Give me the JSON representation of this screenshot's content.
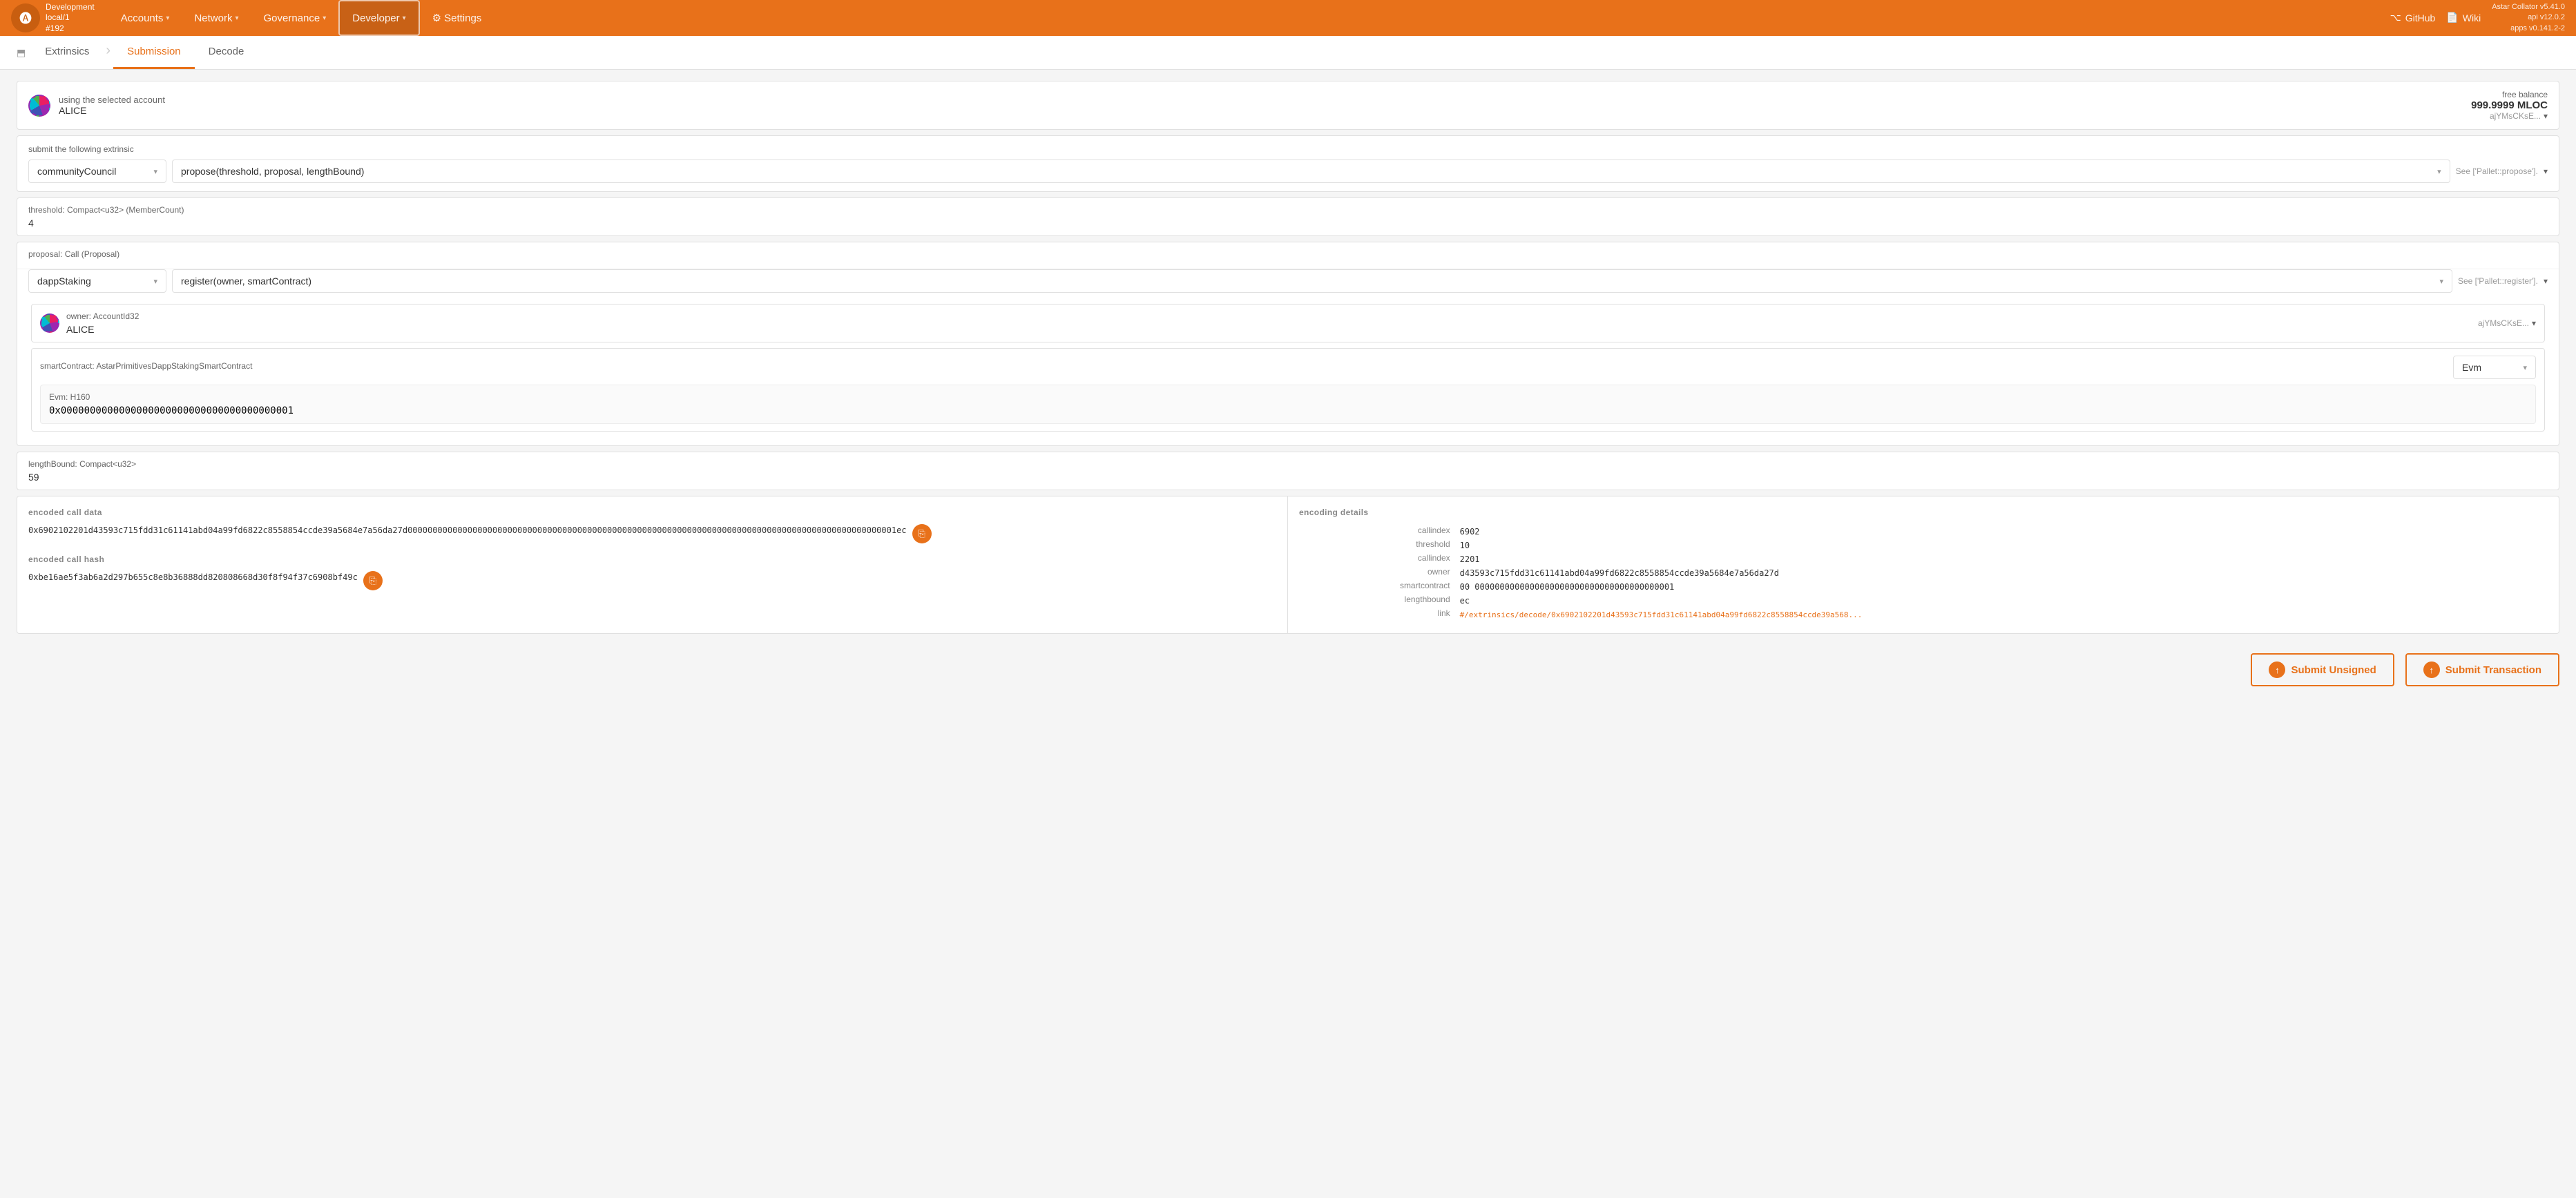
{
  "nav": {
    "logo_text": "A",
    "network_name": "Development",
    "network_sub": "local/1",
    "network_id": "#192",
    "items": [
      {
        "label": "Accounts",
        "has_dropdown": true,
        "active": false
      },
      {
        "label": "Network",
        "has_dropdown": true,
        "active": false
      },
      {
        "label": "Governance",
        "has_dropdown": true,
        "active": false
      },
      {
        "label": "Developer",
        "has_dropdown": true,
        "active": true
      },
      {
        "label": "Settings",
        "has_dropdown": false,
        "active": false
      }
    ],
    "right_items": [
      {
        "label": "GitHub",
        "icon": "github-icon"
      },
      {
        "label": "Wiki",
        "icon": "wiki-icon"
      }
    ],
    "version": "Astar Collator v5.41.0",
    "api_version": "api v12.0.2",
    "apps_version": "apps v0.141.2-2"
  },
  "tabs": {
    "icon": "⬒",
    "items": [
      {
        "label": "Extrinsics",
        "active": false
      },
      {
        "label": "Submission",
        "active": true
      },
      {
        "label": "Decode",
        "active": false
      }
    ]
  },
  "account_section": {
    "label": "using the selected account",
    "account_name": "ALICE",
    "free_balance_label": "free balance",
    "free_balance_value": "999.9999 MLOC",
    "account_address": "ajYMsCKsE..."
  },
  "extrinsic_section": {
    "label": "submit the following extrinsic",
    "pallet": "communityCouncil",
    "call": "propose(threshold, proposal, lengthBound)",
    "see_link": "See ['Pallet::propose']."
  },
  "params": {
    "threshold": {
      "label": "threshold: Compact<u32> (MemberCount)",
      "value": "4"
    },
    "proposal": {
      "label": "proposal: Call (Proposal)",
      "pallet": "dappStaking",
      "call": "register(owner, smartContract)",
      "see_link": "See ['Pallet::register'].",
      "owner": {
        "label": "owner: AccountId32",
        "account_name": "ALICE",
        "account_address": "ajYMsCKsE..."
      },
      "smartContract": {
        "label": "smartContract: AstarPrimitivesDappStakingSmartContract",
        "type": "Evm",
        "evm_label": "Evm: H160",
        "evm_value": "0x0000000000000000000000000000000000000001"
      }
    },
    "lengthBound": {
      "label": "lengthBound: Compact<u32>",
      "value": "59"
    }
  },
  "encoded": {
    "call_data_label": "encoded call data",
    "call_data_value": "0x6902102201d43593c715fdd31c61141abd04a99fd6822c8558854ccde39a5684e7a56da27d00000000000000000000000000000000000000000000000000000000000000000000000000000000000000000000000001ec",
    "call_hash_label": "encoded call hash",
    "call_hash_value": "0xbe16ae5f3ab6a2d297b655c8e8b36888dd820808668d30f8f94f37c6908bf49c",
    "encoding_details_label": "encoding details",
    "details": {
      "callindex_outer": {
        "key": "callindex",
        "value": "6902"
      },
      "threshold": {
        "key": "threshold",
        "value": "10"
      },
      "callindex_inner": {
        "key": "callindex",
        "value": "2201"
      },
      "owner": {
        "key": "owner",
        "value": "d43593c715fdd31c61141abd04a99fd6822c8558854ccde39a5684e7a56da27d"
      },
      "smartcontract": {
        "key": "smartcontract",
        "value": "00 0000000000000000000000000000000000000001"
      },
      "lengthbound": {
        "key": "lengthbound",
        "value": "ec"
      },
      "link_key": "link",
      "link_value": "#/extrinsics/decode/0x6902102201d43593c715fdd31c61141abd04a99fd6822c8558854ccde39a568..."
    }
  },
  "footer": {
    "submit_unsigned_label": "Submit Unsigned",
    "submit_transaction_label": "Submit Transaction"
  }
}
